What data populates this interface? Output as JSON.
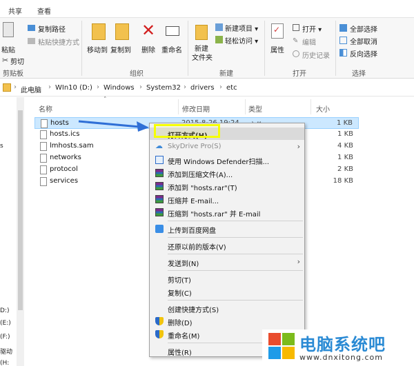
{
  "ribbon_tabs": [
    "共享",
    "查看"
  ],
  "ribbon": {
    "clipboard": {
      "paste": "粘贴",
      "copy_path": "复制路径",
      "paste_shortcut": "粘贴快捷方式",
      "cut": "剪切",
      "group": "剪贴板"
    },
    "organize": {
      "move_to": "移动到",
      "copy_to": "复制到",
      "delete": "删除",
      "rename": "重命名",
      "group": "组织"
    },
    "new": {
      "new_item": "新建项目 ▾",
      "easy_access": "轻松访问 ▾",
      "new_folder": "新建\n文件夹",
      "new_folder_1": "新建",
      "new_folder_2": "文件夹",
      "group": "新建"
    },
    "open": {
      "properties": "属性",
      "open": "打开 ▾",
      "edit": "编辑",
      "history": "历史记录",
      "group": "打开"
    },
    "select": {
      "select_all": "全部选择",
      "select_none": "全部取消",
      "invert": "反向选择",
      "group": "选择"
    }
  },
  "address": {
    "crumbs": [
      "此电脑",
      "WIn10 (D:)",
      "Windows",
      "System32",
      "drivers",
      "etc"
    ]
  },
  "columns": {
    "name": "名称",
    "date": "修改日期",
    "type": "类型",
    "size": "大小"
  },
  "files": [
    {
      "name": "hosts",
      "date": "2015-8-26 19:24",
      "type": "文件",
      "size": "1 KB"
    },
    {
      "name": "hosts.ics",
      "date": "",
      "type": "",
      "size": "1 KB"
    },
    {
      "name": "lmhosts.sam",
      "date": "",
      "type": "",
      "size": "4 KB"
    },
    {
      "name": "networks",
      "date": "",
      "type": "",
      "size": "1 KB"
    },
    {
      "name": "protocol",
      "date": "",
      "type": "",
      "size": "2 KB"
    },
    {
      "name": "services",
      "date": "",
      "type": "",
      "size": "18 KB"
    }
  ],
  "left_pane": [
    "s",
    "D:)",
    "(E:)",
    "(F:)",
    "驱动",
    "(H:"
  ],
  "context_menu": {
    "open_with": "打开方式(H)",
    "skydrive": "SkyDrive Pro(S)",
    "defender": "使用 Windows Defender扫描...",
    "add_archive": "添加到压缩文件(A)...",
    "add_rar": "添加到 \"hosts.rar\"(T)",
    "compress_email": "压缩并 E-mail...",
    "compress_rar_email": "压缩到 \"hosts.rar\" 并 E-mail",
    "upload_baidu": "上传到百度网盘",
    "restore_versions": "还原以前的版本(V)",
    "send_to": "发送到(N)",
    "cut": "剪切(T)",
    "copy": "复制(C)",
    "create_shortcut": "创建快捷方式(S)",
    "delete": "删除(D)",
    "rename": "重命名(M)",
    "properties": "属性(R)"
  },
  "watermark": {
    "title": "电脑系统吧",
    "url": "www.dnxitong.com"
  },
  "colors": {
    "accent": "#2a8ad4",
    "highlight": "#f5ff00",
    "selection": "#cce8ff",
    "arrow": "#2f6fd6"
  }
}
